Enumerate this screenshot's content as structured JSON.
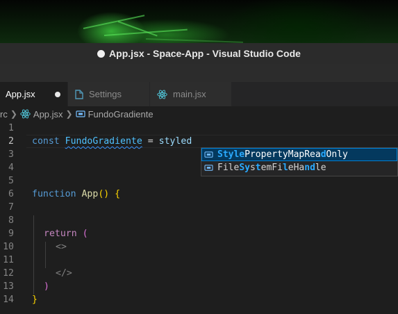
{
  "window": {
    "title": "App.jsx - Space-App - Visual Studio Code"
  },
  "tabs": [
    {
      "label": "App.jsx",
      "active": true,
      "modified": true,
      "icon": "react-icon"
    },
    {
      "label": "Settings",
      "active": false,
      "icon": "file-icon"
    },
    {
      "label": "main.jsx",
      "active": false,
      "icon": "react-icon"
    }
  ],
  "breadcrumb": {
    "folder": "rc",
    "file": "App.jsx",
    "symbol": "FundoGradiente"
  },
  "editor": {
    "line_numbers": [
      "1",
      "2",
      "3",
      "4",
      "5",
      "6",
      "7",
      "8",
      "9",
      "10",
      "11",
      "12",
      "13",
      "14"
    ],
    "current_line": 2,
    "tokens": {
      "l2_const": "const",
      "l2_name": "FundoGradiente",
      "l2_eq": " = ",
      "l2_styled": "styled",
      "l6_function": "function",
      "l6_app": "App",
      "l6_parens": "()",
      "l6_brace": "{",
      "l9_return": "return",
      "l9_paren": "(",
      "l10_open": "<>",
      "l12_close": "</>",
      "l13_paren": ")",
      "l14_brace": "}"
    }
  },
  "suggestions": [
    {
      "parts": [
        "Style",
        "PropertyMapRea",
        "d",
        "Only"
      ],
      "selected": true,
      "icon": "symbol-interface-icon"
    },
    {
      "parts": [
        "File",
        "Sy",
        "s",
        "t",
        "em",
        "Fi",
        "l",
        "e",
        "Ha",
        "n",
        "",
        "d",
        "le"
      ],
      "selected": false,
      "icon": "symbol-interface-icon"
    }
  ],
  "colors": {
    "accent": "#007fd4",
    "background": "#1e1e1e",
    "keyword": "#569cd6"
  }
}
